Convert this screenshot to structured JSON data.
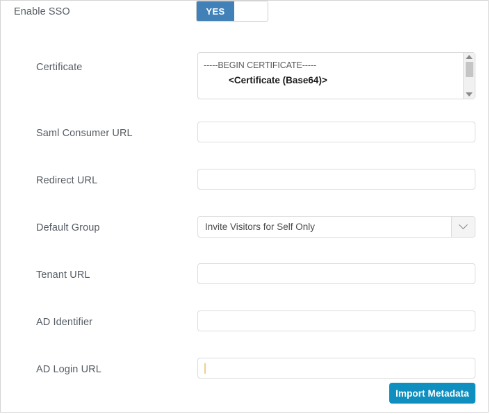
{
  "form": {
    "enable_sso": {
      "label": "Enable SSO",
      "toggle_on_label": "YES",
      "state": "YES"
    },
    "certificate": {
      "label": "Certificate",
      "line1": "-----BEGIN CERTIFICATE-----",
      "line2": "<Certificate (Base64)>",
      "scrollbar": {
        "up_icon": "chevron-up-icon",
        "down_icon": "chevron-down-icon"
      }
    },
    "saml_consumer_url": {
      "label": "Saml Consumer URL",
      "value": "",
      "placeholder": ""
    },
    "redirect_url": {
      "label": "Redirect URL",
      "value": "",
      "placeholder": ""
    },
    "default_group": {
      "label": "Default Group",
      "selected": "Invite Visitors for Self Only",
      "dropdown_icon": "chevron-down-icon"
    },
    "tenant_url": {
      "label": "Tenant URL",
      "value": "",
      "placeholder": ""
    },
    "ad_identifier": {
      "label": "AD Identifier",
      "value": "",
      "placeholder": ""
    },
    "ad_login_url": {
      "label": "AD Login URL",
      "value": "",
      "placeholder": "",
      "focused": true
    },
    "import_button": {
      "label": "Import Metadata"
    }
  },
  "colors": {
    "toggle_on": "#4281b8",
    "primary_button": "#0e8fc0",
    "label_text": "#555c63",
    "panel_border": "#d4d4d4",
    "caret": "#f0cf90"
  }
}
